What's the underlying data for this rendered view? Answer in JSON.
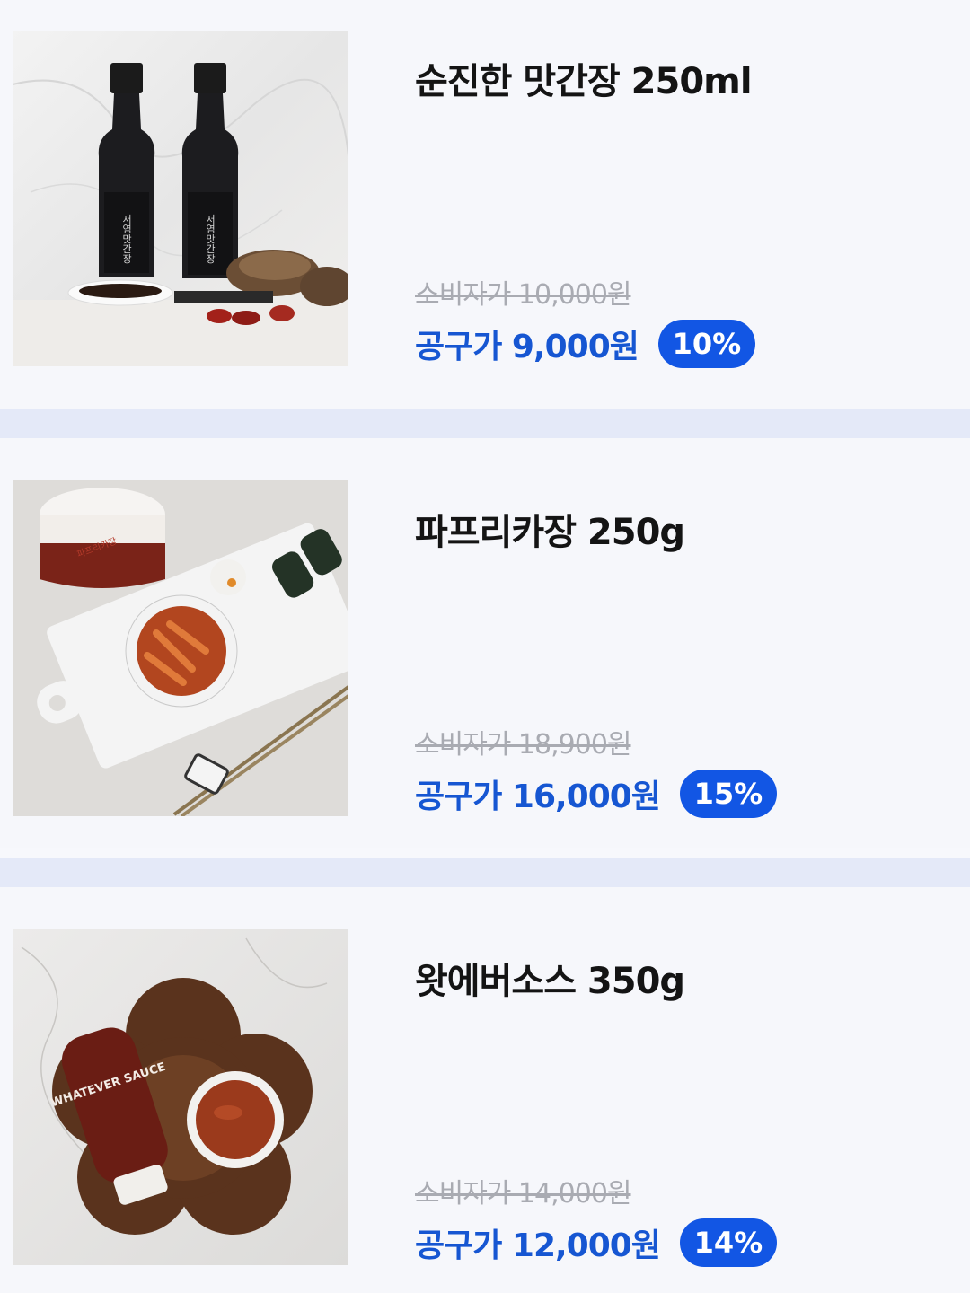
{
  "products": [
    {
      "name": "순진한 맛간장 250ml",
      "original_price": "소비자가 10,000원",
      "sale_price": "공구가 9,000원",
      "discount": "10%",
      "bottle_label": "저염맛간장"
    },
    {
      "name": "파프리카장 250g",
      "original_price": "소비자가 18,900원",
      "sale_price": "공구가 16,000원",
      "discount": "15%",
      "jar_label": "파프리카장"
    },
    {
      "name": "왓에버소스 350g",
      "original_price": "소비자가 14,000원",
      "sale_price": "공구가 12,000원",
      "discount": "14%",
      "bottle_label": "WHATEVER SAUCE"
    }
  ],
  "colors": {
    "accent": "#1256e4",
    "sale_text": "#1656d2",
    "divider": "#e4e9f8"
  }
}
